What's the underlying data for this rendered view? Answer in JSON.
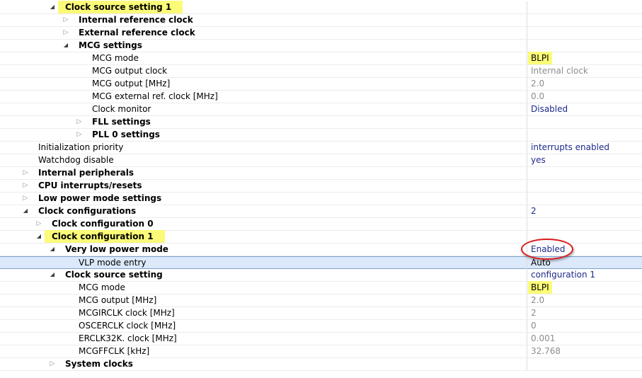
{
  "rows": [
    {
      "label": "Clock source setting 1",
      "value": "",
      "level": 3,
      "toggle": "open",
      "bold": true,
      "highlight": "wide",
      "vstyle": "link"
    },
    {
      "label": "Internal reference clock",
      "value": "",
      "level": 4,
      "toggle": "closed",
      "bold": true,
      "vstyle": "link"
    },
    {
      "label": "External reference clock",
      "value": "",
      "level": 4,
      "toggle": "closed",
      "bold": true,
      "vstyle": "link"
    },
    {
      "label": "MCG settings",
      "value": "",
      "level": 4,
      "toggle": "open",
      "bold": true,
      "vstyle": "link"
    },
    {
      "label": "MCG mode",
      "value": "BLPI",
      "level": 5,
      "toggle": "none",
      "bold": false,
      "vstyle": "dark",
      "vhighlight": true
    },
    {
      "label": "MCG output clock",
      "value": "Internal clock",
      "level": 5,
      "toggle": "none",
      "bold": false,
      "vstyle": "dim"
    },
    {
      "label": "MCG output [MHz]",
      "value": "2.0",
      "level": 5,
      "toggle": "none",
      "bold": false,
      "vstyle": "dim"
    },
    {
      "label": "MCG external ref. clock [MHz]",
      "value": "0.0",
      "level": 5,
      "toggle": "none",
      "bold": false,
      "vstyle": "dim"
    },
    {
      "label": "Clock monitor",
      "value": "Disabled",
      "level": 5,
      "toggle": "none",
      "bold": false,
      "vstyle": "link"
    },
    {
      "label": "FLL settings",
      "value": "",
      "level": 5,
      "toggle": "closed",
      "bold": true,
      "vstyle": "link"
    },
    {
      "label": "PLL 0 settings",
      "value": "",
      "level": 5,
      "toggle": "closed",
      "bold": true,
      "vstyle": "link"
    },
    {
      "label": "Initialization priority",
      "value": "interrupts enabled",
      "level": 1,
      "toggle": "none",
      "bold": false,
      "vstyle": "link"
    },
    {
      "label": "Watchdog disable",
      "value": "yes",
      "level": 1,
      "toggle": "none",
      "bold": false,
      "vstyle": "link"
    },
    {
      "label": "Internal peripherals",
      "value": "",
      "level": 1,
      "toggle": "closed",
      "bold": true,
      "vstyle": "link"
    },
    {
      "label": "CPU interrupts/resets",
      "value": "",
      "level": 1,
      "toggle": "closed",
      "bold": true,
      "vstyle": "link"
    },
    {
      "label": "Low power mode settings",
      "value": "",
      "level": 1,
      "toggle": "closed",
      "bold": true,
      "vstyle": "link"
    },
    {
      "label": "Clock configurations",
      "value": "2",
      "level": 1,
      "toggle": "open",
      "bold": true,
      "vstyle": "link"
    },
    {
      "label": "Clock configuration 0",
      "value": "",
      "level": 2,
      "toggle": "closed",
      "bold": true,
      "vstyle": "link"
    },
    {
      "label": "Clock configuration 1",
      "value": "",
      "level": 2,
      "toggle": "open",
      "bold": true,
      "highlight": "wide",
      "vstyle": "link"
    },
    {
      "label": "Very low power mode",
      "value": "Enabled",
      "level": 3,
      "toggle": "open",
      "bold": true,
      "vstyle": "link"
    },
    {
      "label": "VLP mode entry",
      "value": "Auto",
      "level": 4,
      "toggle": "none",
      "bold": false,
      "vstyle": "dark",
      "selected": true
    },
    {
      "label": "Clock source setting",
      "value": "configuration 1",
      "level": 3,
      "toggle": "open",
      "bold": true,
      "vstyle": "link"
    },
    {
      "label": "MCG mode",
      "value": "BLPI",
      "level": 4,
      "toggle": "none",
      "bold": false,
      "vstyle": "dark",
      "vhighlight": true
    },
    {
      "label": "MCG output [MHz]",
      "value": "2.0",
      "level": 4,
      "toggle": "none",
      "bold": false,
      "vstyle": "dim"
    },
    {
      "label": "MCGIRCLK clock [MHz]",
      "value": "2",
      "level": 4,
      "toggle": "none",
      "bold": false,
      "vstyle": "dim"
    },
    {
      "label": "OSCERCLK clock [MHz]",
      "value": "0",
      "level": 4,
      "toggle": "none",
      "bold": false,
      "vstyle": "dim"
    },
    {
      "label": "ERCLK32K. clock [MHz]",
      "value": "0.001",
      "level": 4,
      "toggle": "none",
      "bold": false,
      "vstyle": "dim"
    },
    {
      "label": "MCGFFCLK [kHz]",
      "value": "32.768",
      "level": 4,
      "toggle": "none",
      "bold": false,
      "vstyle": "dim"
    },
    {
      "label": "System clocks",
      "value": "",
      "level": 3,
      "toggle": "closed",
      "bold": true,
      "vstyle": "link"
    }
  ],
  "colors": {
    "highlight": "#fbfb78",
    "link_value": "#1c2a8a",
    "dim_value": "#8c8c8c",
    "annotation_ellipse": "#d91a1a",
    "selection": "#dce9fa"
  }
}
